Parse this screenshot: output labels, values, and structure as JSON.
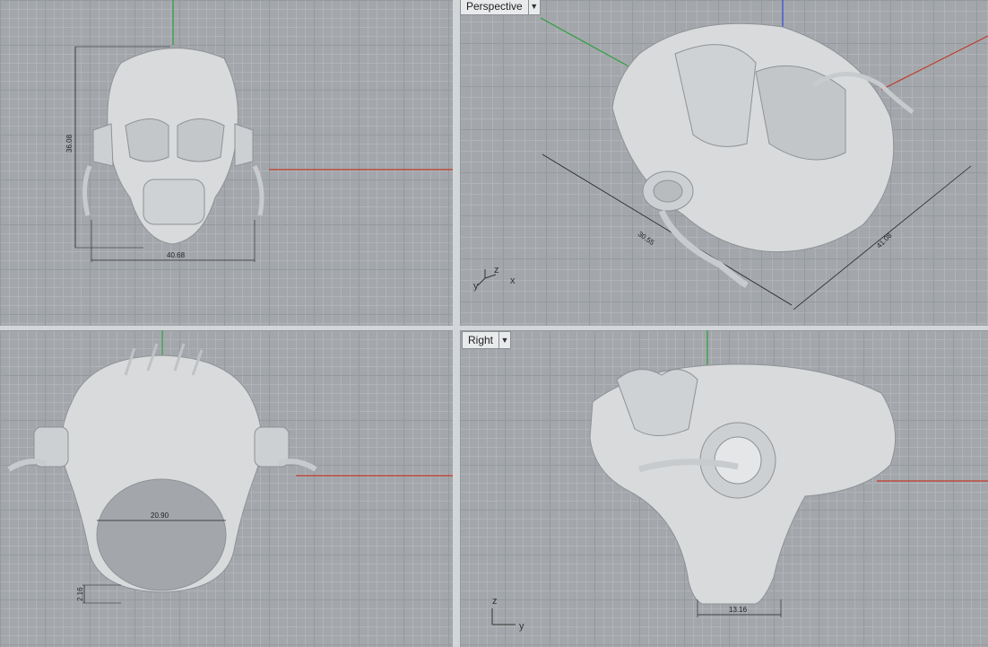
{
  "viewports": {
    "top": {
      "dims": {
        "height": "36.08",
        "width": "40.68"
      }
    },
    "perspective": {
      "label": "Perspective",
      "dims": {
        "a": "30.55",
        "b": "41.08"
      },
      "axes": {
        "y": "y",
        "z": "z",
        "x": "x"
      }
    },
    "front": {
      "dims": {
        "inner": "20.90",
        "band": "2.16"
      }
    },
    "right": {
      "label": "Right",
      "dims": {
        "width": "13.16"
      },
      "axes": {
        "z": "z",
        "y": "y"
      }
    }
  },
  "colors": {
    "x_axis": "#c0392b",
    "y_axis": "#2e9e3e",
    "z_axis": "#3344cc",
    "model": "#d7d9db"
  },
  "icons": {
    "dropdown": "chevron-down-icon"
  }
}
